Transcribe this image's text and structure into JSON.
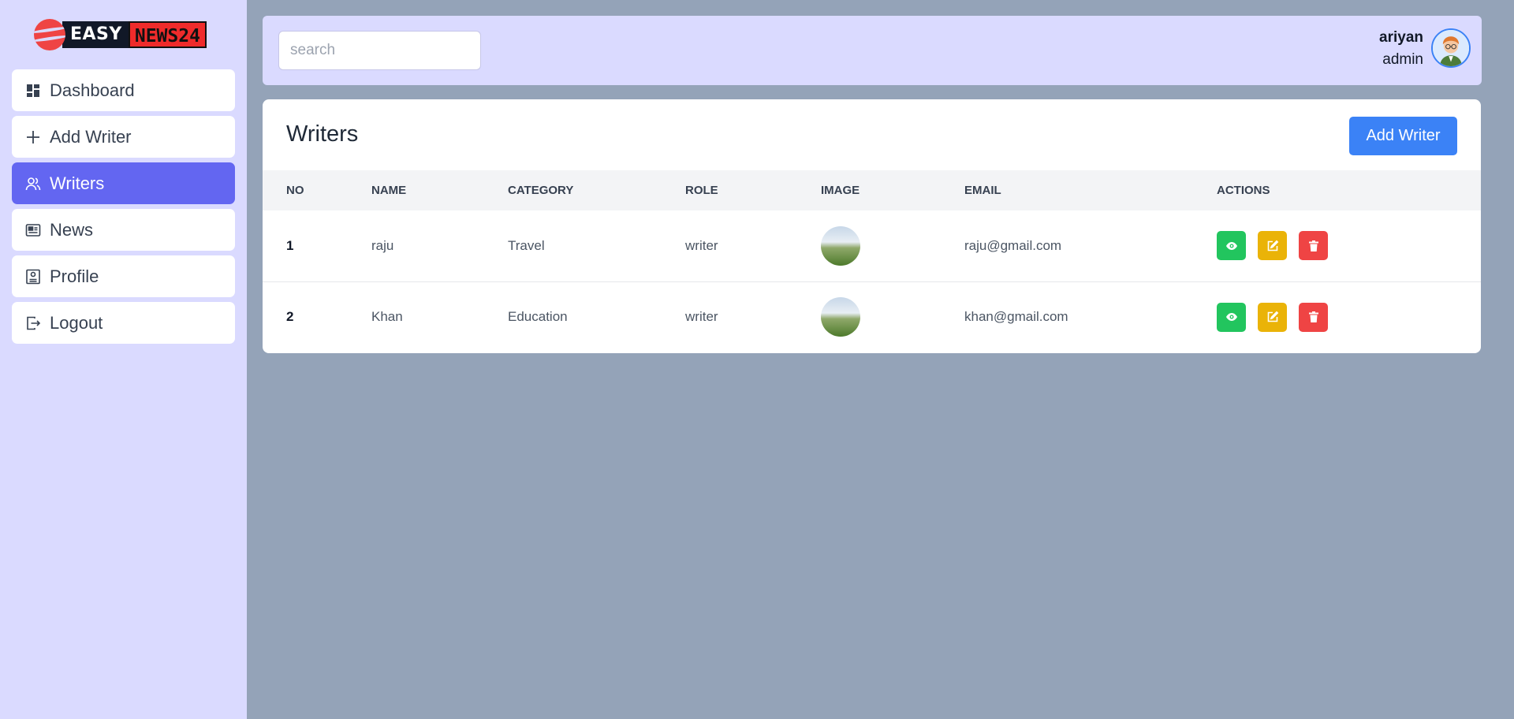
{
  "brand": {
    "part1": "EASY",
    "part2": "NEWS24"
  },
  "sidebar": {
    "items": [
      {
        "label": "Dashboard",
        "icon": "dashboard-icon",
        "active": false
      },
      {
        "label": "Add Writer",
        "icon": "plus-icon",
        "active": false
      },
      {
        "label": "Writers",
        "icon": "users-icon",
        "active": true
      },
      {
        "label": "News",
        "icon": "newspaper-icon",
        "active": false
      },
      {
        "label": "Profile",
        "icon": "profile-icon",
        "active": false
      },
      {
        "label": "Logout",
        "icon": "logout-icon",
        "active": false
      }
    ]
  },
  "header": {
    "search_placeholder": "search",
    "user_name": "ariyan",
    "user_role": "admin"
  },
  "writers": {
    "title": "Writers",
    "add_button": "Add Writer",
    "columns": [
      "NO",
      "NAME",
      "CATEGORY",
      "ROLE",
      "IMAGE",
      "EMAIL",
      "ACTIONS"
    ],
    "rows": [
      {
        "no": "1",
        "name": "raju",
        "category": "Travel",
        "role": "writer",
        "email": "raju@gmail.com"
      },
      {
        "no": "2",
        "name": "Khan",
        "category": "Education",
        "role": "writer",
        "email": "khan@gmail.com"
      }
    ]
  },
  "colors": {
    "sidebar_bg": "#dadaff",
    "active_nav": "#6366f1",
    "page_bg": "#94a3b8",
    "primary": "#3b82f6",
    "view": "#22c55e",
    "edit": "#eab308",
    "delete": "#ef4444"
  }
}
